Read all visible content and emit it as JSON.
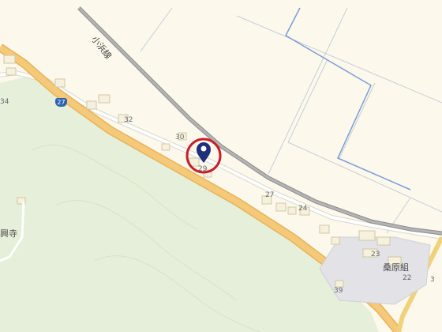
{
  "map": {
    "rail_line_name": "小浜線",
    "route_shield": "27",
    "house_numbers": [
      "34",
      "32",
      "30",
      "29",
      "27",
      "24",
      "23",
      "22",
      "39",
      "3"
    ],
    "place_labels": {
      "temple": "興寺",
      "company": "桑原組"
    },
    "colors": {
      "background": "#fcf9ec",
      "forest": "#e6efda",
      "national_road": "#f5c97a",
      "rail": "#9a9a9a",
      "marker": "#1f2f7a",
      "highlight_circle": "#c81e2a",
      "route_shield": "#2c62b3"
    },
    "icons": [
      "location-pin-icon",
      "highlight-circle"
    ]
  }
}
